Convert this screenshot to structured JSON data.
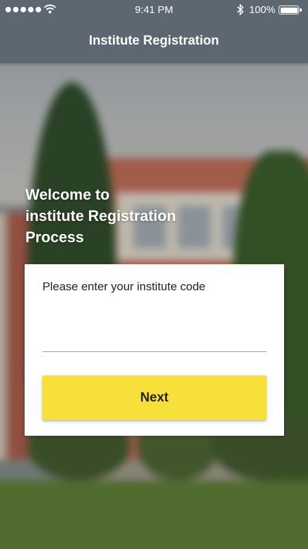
{
  "status_bar": {
    "signal_icon": "signal-dots-icon",
    "wifi_icon": "wifi-icon",
    "time": "9:41 PM",
    "bluetooth_icon": "bluetooth-icon",
    "battery_percent": "100%",
    "battery_icon": "battery-icon"
  },
  "header": {
    "title": "Institute Registration",
    "background_color": "#5c6771"
  },
  "welcome": {
    "line1": "Welcome to",
    "line2": "institute Registration",
    "line3": "Process"
  },
  "form": {
    "label": "Please enter your institute code",
    "input_value": "",
    "input_placeholder": "",
    "next_label": "Next",
    "accent_color": "#f7e03a"
  }
}
